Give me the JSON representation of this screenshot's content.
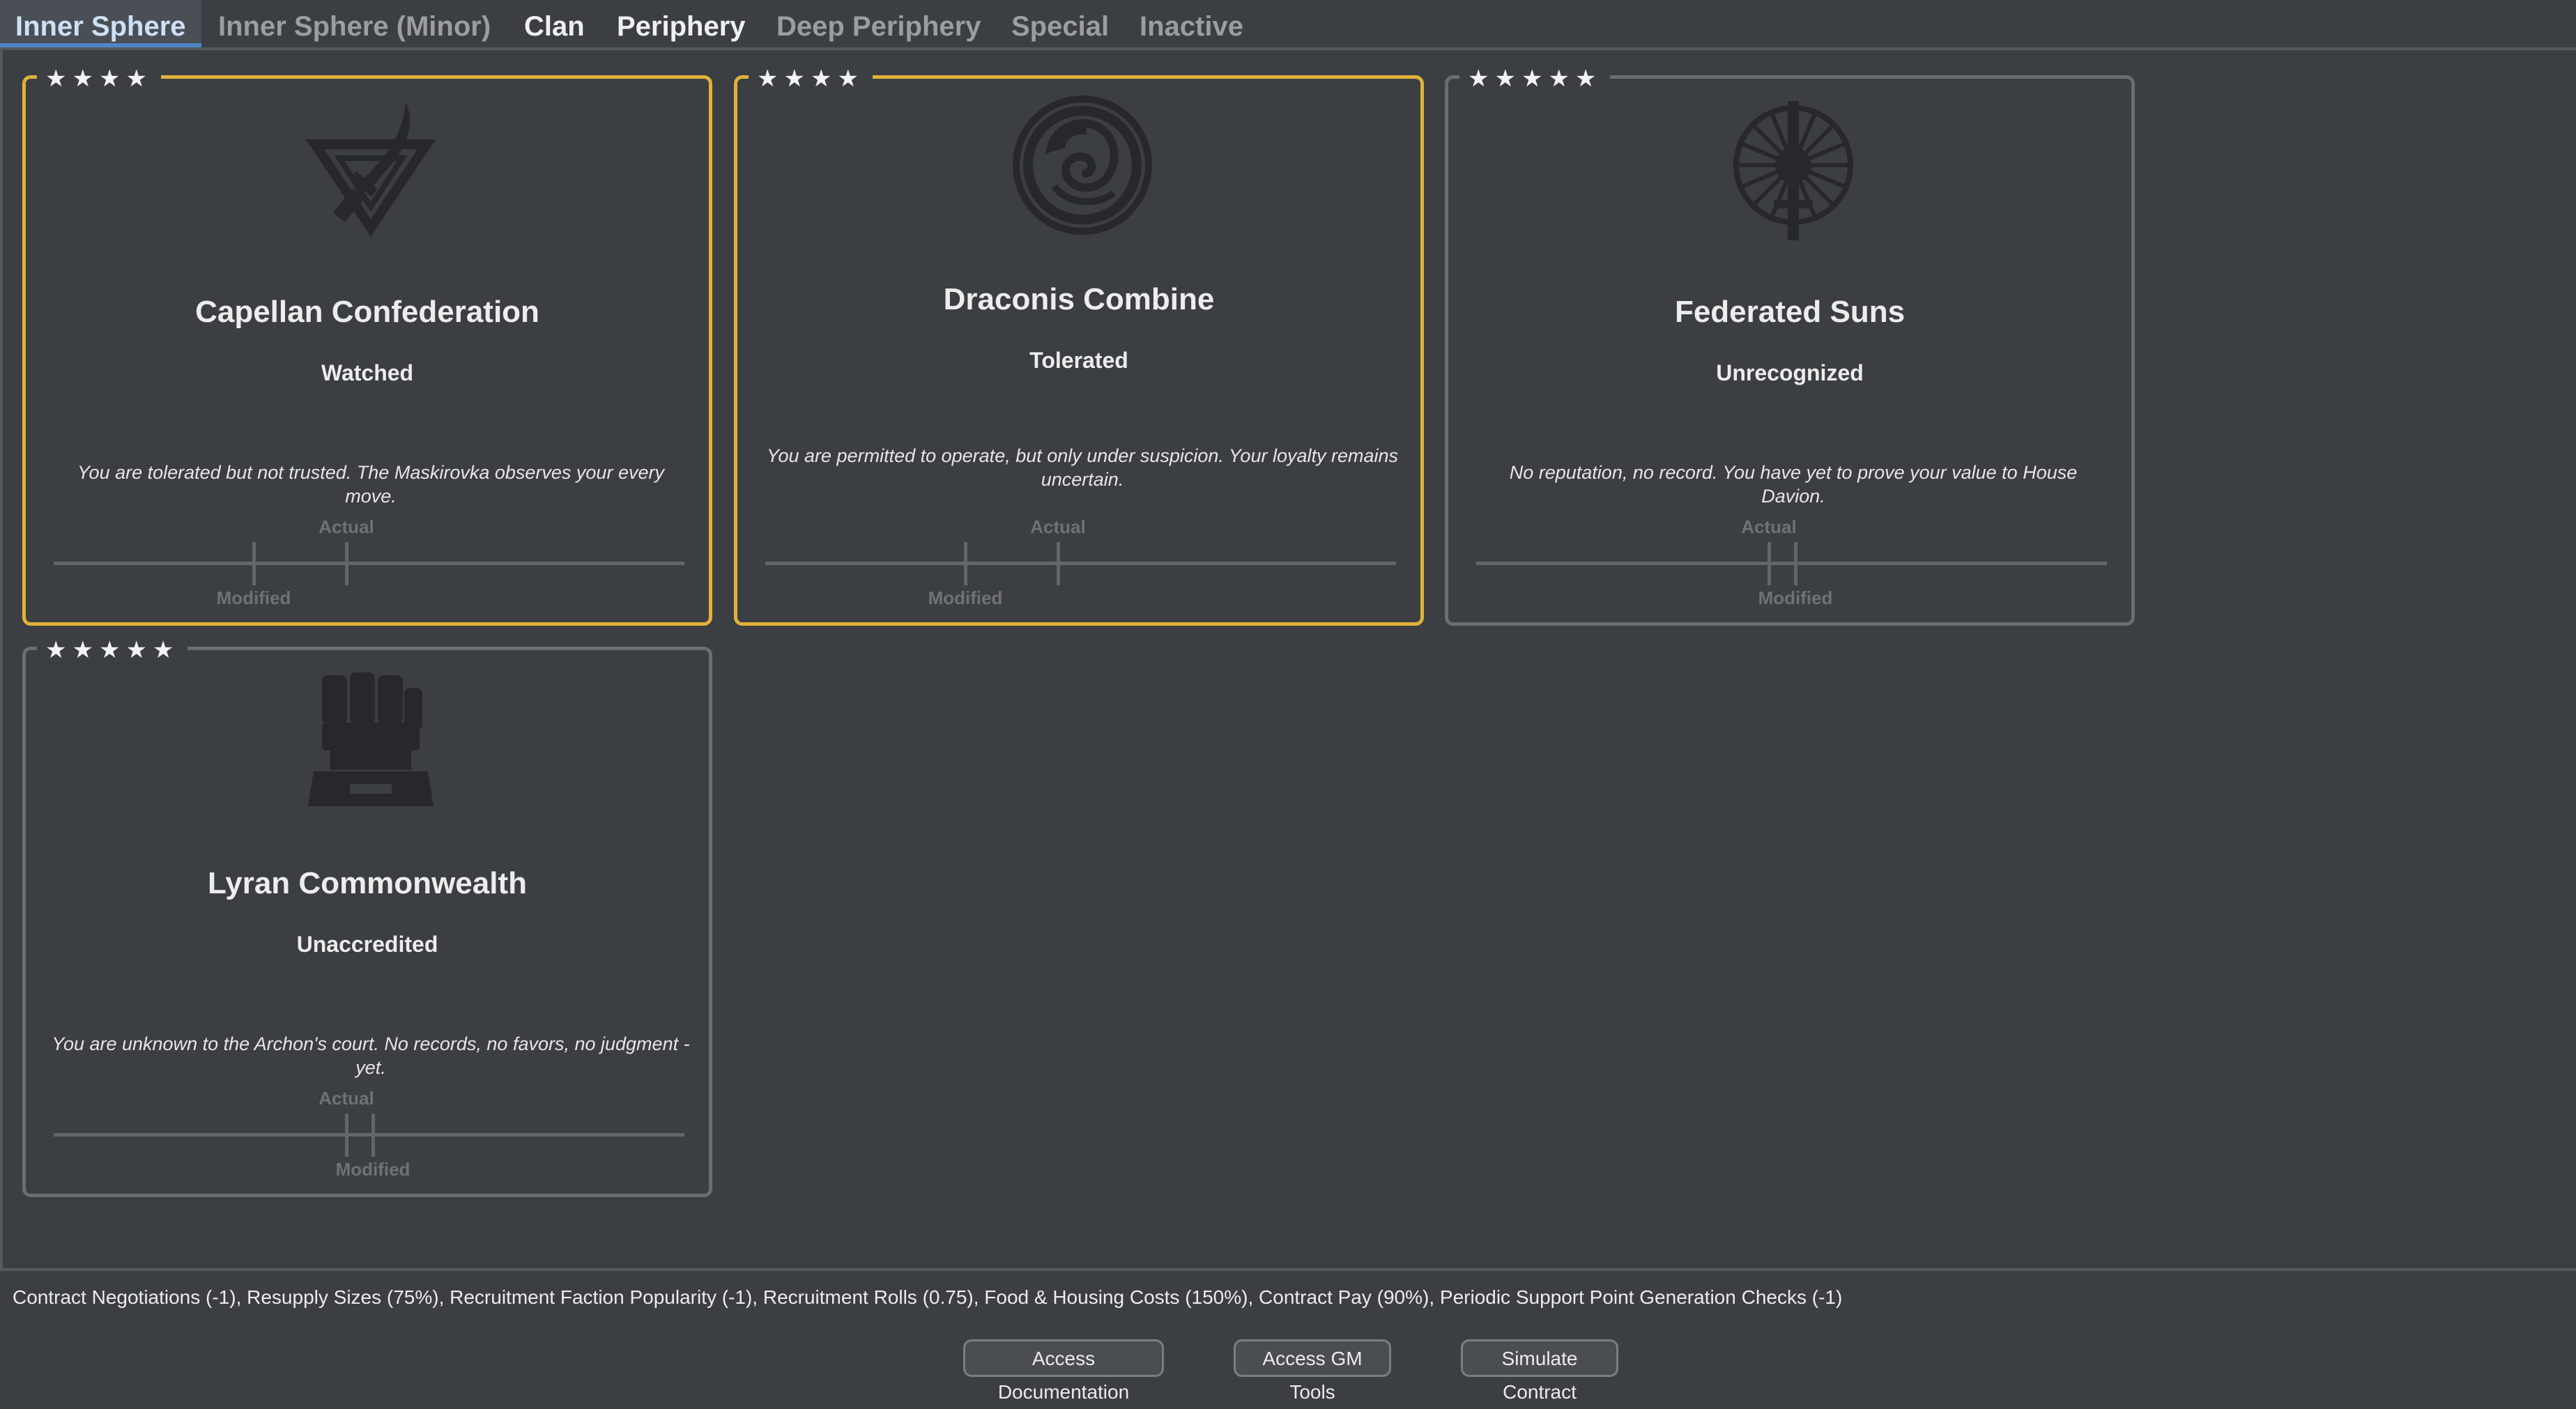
{
  "tabs": [
    {
      "label": "Inner Sphere",
      "state": "active"
    },
    {
      "label": "Inner Sphere (Minor)",
      "state": "dim"
    },
    {
      "label": "Clan",
      "state": "normal"
    },
    {
      "label": "Periphery",
      "state": "normal"
    },
    {
      "label": "Deep Periphery",
      "state": "dim"
    },
    {
      "label": "Special",
      "state": "dim"
    },
    {
      "label": "Inactive",
      "state": "dim"
    }
  ],
  "factions": [
    {
      "stars": "★★★★",
      "name": "Capellan Confederation",
      "status": "Watched",
      "description": "You are tolerated but not trusted. The Maskirovka observes your every move.",
      "actual_label": "Actual",
      "modified_label": "Modified",
      "emblem": "capellan-sword-triangle-icon"
    },
    {
      "stars": "★★★★",
      "name": "Draconis Combine",
      "status": "Tolerated",
      "description": "You are permitted to operate, but only under suspicion. Your loyalty remains uncertain.",
      "actual_label": "Actual",
      "modified_label": "Modified",
      "emblem": "dragon-icon"
    },
    {
      "stars": "★★★★★",
      "name": "Federated Suns",
      "status": "Unrecognized",
      "description": "No reputation, no record. You have yet to prove your value to House Davion.",
      "actual_label": "Actual",
      "modified_label": "Modified",
      "emblem": "sunburst-sword-icon"
    },
    {
      "stars": "★★★★★",
      "name": "Lyran Commonwealth",
      "status": "Unaccredited",
      "description": "You are unknown to the Archon's court. No records, no favors, no judgment - yet.",
      "actual_label": "Actual",
      "modified_label": "Modified",
      "emblem": "mailed-fist-icon"
    }
  ],
  "effects_text": "Contract Negotiations (-1), Resupply Sizes (75%), Recruitment Faction Popularity (-1), Recruitment Rolls (0.75), Food & Housing Costs (150%), Contract Pay (90%), Periodic Support Point Generation Checks (-1)",
  "buttons": {
    "docs": "Access Documentation",
    "gm": "Access GM Tools",
    "simulate": "Simulate Contract"
  },
  "colors": {
    "background": "#3b3e42",
    "selected_border": "#e0b23a",
    "active_tab_accent": "#4f86c6"
  }
}
